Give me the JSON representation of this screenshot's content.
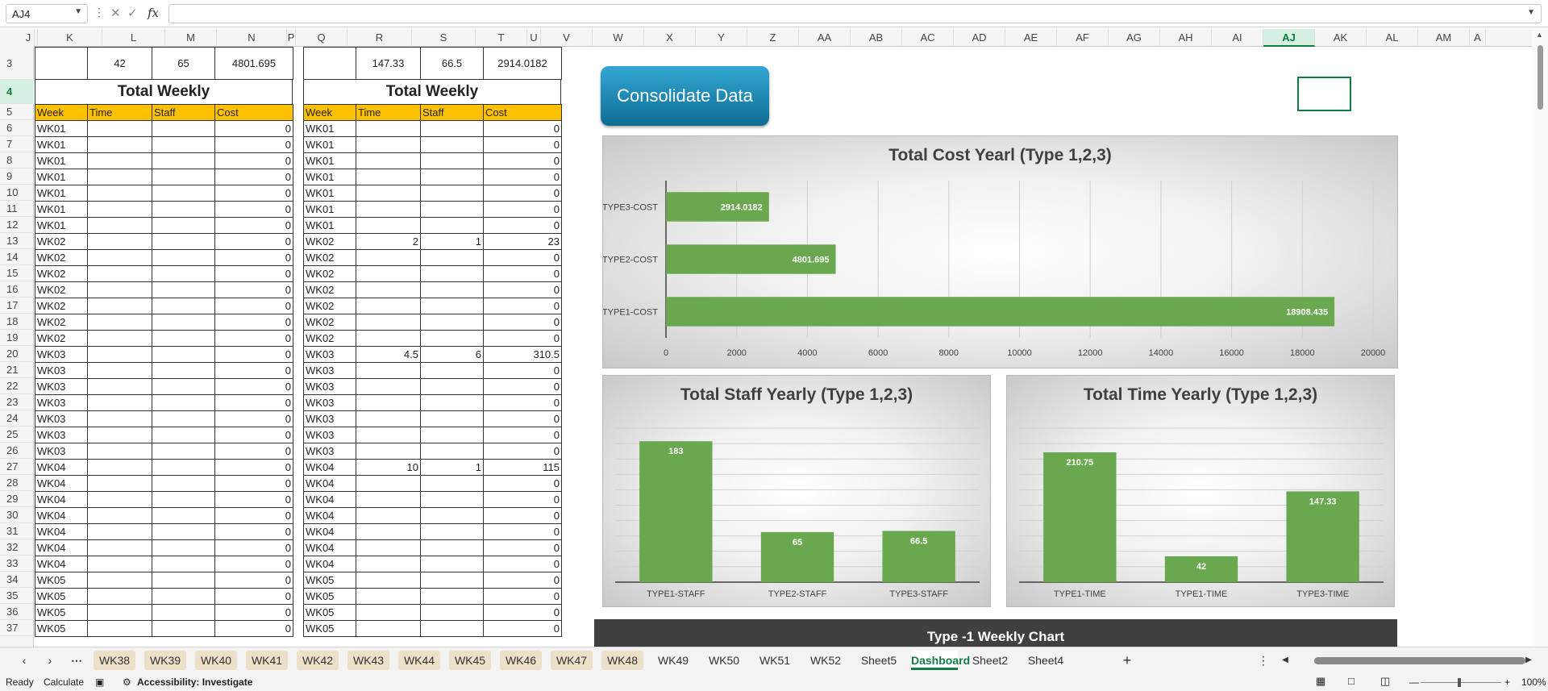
{
  "formula_bar": {
    "name_box": "AJ4",
    "fx_label": "fx",
    "formula": ""
  },
  "columns": [
    {
      "n": "J",
      "sel": false
    },
    {
      "n": "K",
      "sel": false
    },
    {
      "n": "L",
      "sel": false
    },
    {
      "n": "M",
      "sel": false
    },
    {
      "n": "N",
      "sel": false
    },
    {
      "n": "P",
      "sel": false
    },
    {
      "n": "Q",
      "sel": false
    },
    {
      "n": "R",
      "sel": false
    },
    {
      "n": "S",
      "sel": false
    },
    {
      "n": "T",
      "sel": false
    },
    {
      "n": "U",
      "sel": false
    },
    {
      "n": "V",
      "sel": false
    },
    {
      "n": "W",
      "sel": false
    },
    {
      "n": "X",
      "sel": false
    },
    {
      "n": "Y",
      "sel": false
    },
    {
      "n": "Z",
      "sel": false
    },
    {
      "n": "AA",
      "sel": false
    },
    {
      "n": "AB",
      "sel": false
    },
    {
      "n": "AC",
      "sel": false
    },
    {
      "n": "AD",
      "sel": false
    },
    {
      "n": "AE",
      "sel": false
    },
    {
      "n": "AF",
      "sel": false
    },
    {
      "n": "AG",
      "sel": false
    },
    {
      "n": "AH",
      "sel": false
    },
    {
      "n": "AI",
      "sel": false
    },
    {
      "n": "AJ",
      "sel": true
    },
    {
      "n": "AK",
      "sel": false
    },
    {
      "n": "AL",
      "sel": false
    },
    {
      "n": "AM",
      "sel": false
    },
    {
      "n": "A",
      "sel": false
    }
  ],
  "rows": [
    "3",
    "4",
    "5",
    "6",
    "7",
    "8",
    "9",
    "10",
    "11",
    "12",
    "13",
    "14",
    "15",
    "16",
    "17",
    "18",
    "19",
    "20",
    "21",
    "22",
    "23",
    "24",
    "25",
    "26",
    "27",
    "28",
    "29",
    "30",
    "31",
    "32",
    "33",
    "34",
    "35",
    "36",
    "37"
  ],
  "table1": {
    "top_row": [
      "",
      "42",
      "65",
      "4801.695"
    ],
    "title": "Total Weekly",
    "headers": [
      "Week",
      "Time",
      "Staff",
      "Cost"
    ],
    "rows": [
      [
        "WK01",
        "",
        "",
        "0"
      ],
      [
        "WK01",
        "",
        "",
        "0"
      ],
      [
        "WK01",
        "",
        "",
        "0"
      ],
      [
        "WK01",
        "",
        "",
        "0"
      ],
      [
        "WK01",
        "",
        "",
        "0"
      ],
      [
        "WK01",
        "",
        "",
        "0"
      ],
      [
        "WK01",
        "",
        "",
        "0"
      ],
      [
        "WK02",
        "",
        "",
        "0"
      ],
      [
        "WK02",
        "",
        "",
        "0"
      ],
      [
        "WK02",
        "",
        "",
        "0"
      ],
      [
        "WK02",
        "",
        "",
        "0"
      ],
      [
        "WK02",
        "",
        "",
        "0"
      ],
      [
        "WK02",
        "",
        "",
        "0"
      ],
      [
        "WK02",
        "",
        "",
        "0"
      ],
      [
        "WK03",
        "",
        "",
        "0"
      ],
      [
        "WK03",
        "",
        "",
        "0"
      ],
      [
        "WK03",
        "",
        "",
        "0"
      ],
      [
        "WK03",
        "",
        "",
        "0"
      ],
      [
        "WK03",
        "",
        "",
        "0"
      ],
      [
        "WK03",
        "",
        "",
        "0"
      ],
      [
        "WK03",
        "",
        "",
        "0"
      ],
      [
        "WK04",
        "",
        "",
        "0"
      ],
      [
        "WK04",
        "",
        "",
        "0"
      ],
      [
        "WK04",
        "",
        "",
        "0"
      ],
      [
        "WK04",
        "",
        "",
        "0"
      ],
      [
        "WK04",
        "",
        "",
        "0"
      ],
      [
        "WK04",
        "",
        "",
        "0"
      ],
      [
        "WK04",
        "",
        "",
        "0"
      ],
      [
        "WK05",
        "",
        "",
        "0"
      ],
      [
        "WK05",
        "",
        "",
        "0"
      ],
      [
        "WK05",
        "",
        "",
        "0"
      ],
      [
        "WK05",
        "",
        "",
        "0"
      ]
    ]
  },
  "table2": {
    "top_row": [
      "",
      "147.33",
      "66.5",
      "2914.0182"
    ],
    "title": "Total Weekly",
    "headers": [
      "Week",
      "Time",
      "Staff",
      "Cost"
    ],
    "rows": [
      [
        "WK01",
        "",
        "",
        "0"
      ],
      [
        "WK01",
        "",
        "",
        "0"
      ],
      [
        "WK01",
        "",
        "",
        "0"
      ],
      [
        "WK01",
        "",
        "",
        "0"
      ],
      [
        "WK01",
        "",
        "",
        "0"
      ],
      [
        "WK01",
        "",
        "",
        "0"
      ],
      [
        "WK01",
        "",
        "",
        "0"
      ],
      [
        "WK02",
        "2",
        "1",
        "23"
      ],
      [
        "WK02",
        "",
        "",
        "0"
      ],
      [
        "WK02",
        "",
        "",
        "0"
      ],
      [
        "WK02",
        "",
        "",
        "0"
      ],
      [
        "WK02",
        "",
        "",
        "0"
      ],
      [
        "WK02",
        "",
        "",
        "0"
      ],
      [
        "WK02",
        "",
        "",
        "0"
      ],
      [
        "WK03",
        "4.5",
        "6",
        "310.5"
      ],
      [
        "WK03",
        "",
        "",
        "0"
      ],
      [
        "WK03",
        "",
        "",
        "0"
      ],
      [
        "WK03",
        "",
        "",
        "0"
      ],
      [
        "WK03",
        "",
        "",
        "0"
      ],
      [
        "WK03",
        "",
        "",
        "0"
      ],
      [
        "WK03",
        "",
        "",
        "0"
      ],
      [
        "WK04",
        "10",
        "1",
        "115"
      ],
      [
        "WK04",
        "",
        "",
        "0"
      ],
      [
        "WK04",
        "",
        "",
        "0"
      ],
      [
        "WK04",
        "",
        "",
        "0"
      ],
      [
        "WK04",
        "",
        "",
        "0"
      ],
      [
        "WK04",
        "",
        "",
        "0"
      ],
      [
        "WK04",
        "",
        "",
        "0"
      ],
      [
        "WK05",
        "",
        "",
        "0"
      ],
      [
        "WK05",
        "",
        "",
        "0"
      ],
      [
        "WK05",
        "",
        "",
        "0"
      ],
      [
        "WK05",
        "",
        "",
        "0"
      ]
    ]
  },
  "consolidate_button": "Consolidate Data",
  "bar_color": "#6aa84f",
  "chart_data": [
    {
      "type": "bar",
      "orientation": "horizontal",
      "title": "Total Cost Yearl (Type 1,2,3)",
      "categories": [
        "TYPE3-COST",
        "TYPE2-COST",
        "TYPE1-COST"
      ],
      "values": [
        2914.0182,
        4801.695,
        18908.435
      ],
      "xlim": [
        0,
        20000
      ],
      "ticks": [
        0,
        2000,
        4000,
        6000,
        8000,
        10000,
        12000,
        14000,
        16000,
        18000,
        20000
      ],
      "data_labels": true,
      "grid": true
    },
    {
      "type": "bar",
      "title": "Total Staff Yearly (Type 1,2,3)",
      "categories": [
        "TYPE1-STAFF",
        "TYPE2-STAFF",
        "TYPE3-STAFF"
      ],
      "values": [
        183,
        65,
        66.5
      ],
      "ylim": [
        0,
        200
      ],
      "data_labels": true,
      "grid": true
    },
    {
      "type": "bar",
      "title": "Total Time Yearly (Type 1,2,3)",
      "categories": [
        "TYPE1-TIME",
        "TYPE1-TIME",
        "TYPE3-TIME"
      ],
      "values": [
        210.75,
        42,
        147.33
      ],
      "ylim": [
        0,
        250
      ],
      "data_labels": true,
      "grid": true
    }
  ],
  "weekly_chart_title": "Type -1 Weekly Chart",
  "sheet_tabs": [
    {
      "n": "WK38",
      "k": "old"
    },
    {
      "n": "WK39",
      "k": "old"
    },
    {
      "n": "WK40",
      "k": "old"
    },
    {
      "n": "WK41",
      "k": "old"
    },
    {
      "n": "WK42",
      "k": "old"
    },
    {
      "n": "WK43",
      "k": "old"
    },
    {
      "n": "WK44",
      "k": "old"
    },
    {
      "n": "WK45",
      "k": "old"
    },
    {
      "n": "WK46",
      "k": "old"
    },
    {
      "n": "WK47",
      "k": "old"
    },
    {
      "n": "WK48",
      "k": "old"
    },
    {
      "n": "WK49",
      "k": ""
    },
    {
      "n": "WK50",
      "k": ""
    },
    {
      "n": "WK51",
      "k": ""
    },
    {
      "n": "WK52",
      "k": ""
    },
    {
      "n": "Sheet5",
      "k": ""
    },
    {
      "n": "Dashboard",
      "k": "active"
    },
    {
      "n": "Sheet2",
      "k": ""
    },
    {
      "n": "Sheet4",
      "k": ""
    }
  ],
  "status": {
    "ready": "Ready",
    "calculate": "Calculate",
    "accessibility": "Accessibility: Investigate",
    "zoom": "100%"
  }
}
